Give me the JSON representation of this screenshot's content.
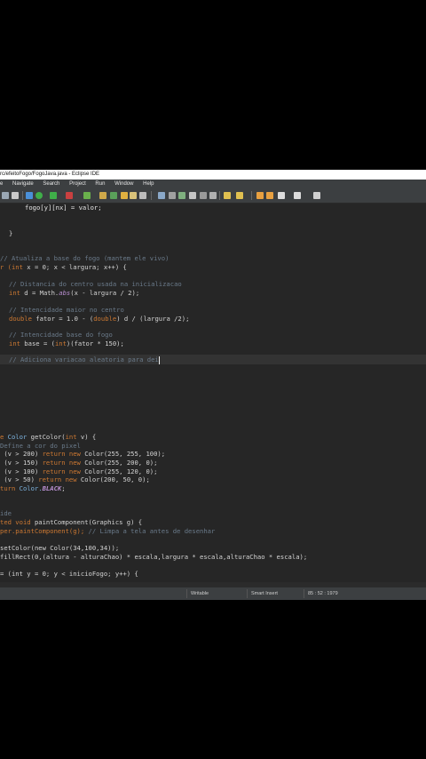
{
  "window": {
    "title": "rc/efeitoFogo/FogoJava.java - Eclipse IDE"
  },
  "menu": [
    "e",
    "Navigate",
    "Search",
    "Project",
    "Run",
    "Window",
    "Help"
  ],
  "editor": {
    "lines": {
      "l1": "fogo[y][nx] = valor;",
      "l2": "}",
      "l3": "// Atualiza a base do fogo (mantem ele vivo)",
      "l4_kw": "r (",
      "l4_int": "int",
      "l4_rest": " x = 0; x < largura; x++) {",
      "l5": "// Distancia do centro usada na inicializacao",
      "l6_int": "int",
      "l6_rest": " d = Math.",
      "l6_abs": "abs",
      "l6_tail": "(x - largura / 2);",
      "l7": "// Intencidade maior no centro",
      "l8_double": "double",
      "l8_rest": " fator = 1.0 - (",
      "l8_double2": "double",
      "l8_tail": ") d / (largura /2);",
      "l9": "// Intencidade base do fogo",
      "l10_int": "int",
      "l10_rest": " base = (",
      "l10_int2": "int",
      "l10_tail": ")(fator * 150);",
      "l11": "// Adiciona variacao aleatoria para dei",
      "l12_a": "e ",
      "l12_color": "Color",
      "l12_b": " getColor(",
      "l12_int": "int",
      "l12_c": " v) {",
      "l13": "Define a cor do pixel",
      "l14_a": " (v > 200) ",
      "l14_ret": "return new ",
      "l14_b": "Color(255, 255, 100);",
      "l15_a": " (v > 150) ",
      "l15_ret": "return new ",
      "l15_b": "Color(255, 200, 0);",
      "l16_a": " (v > 100) ",
      "l16_ret": "return new ",
      "l16_b": "Color(255, 120, 0);",
      "l17_a": " (v > 50) ",
      "l17_ret": "return new ",
      "l17_b": "Color(200, 50, 0);",
      "l18_a": "turn ",
      "l18_b": "Color.",
      "l18_c": "BLACK",
      "l18_d": ";",
      "l19": "ide",
      "l20_a": "ted void ",
      "l20_b": "paintComponent(Graphics g) {",
      "l21_a": "per.paintComponent(g); ",
      "l21_b": "// Limpa a tela antes de desenhar",
      "l22": "setColor(new Color(34,100,34));",
      "l23": "fillRect(0,(altura - alturaChao) * escala,largura * escala,alturaChao * escala);",
      "l24": "= (int y = 0; y < inicioFogo; y++) {"
    }
  },
  "status": {
    "writable": "Writable",
    "insert_mode": "Smart Insert",
    "position": "85 : 52 : 1979"
  },
  "colors": {
    "editor_bg": "#262626",
    "keyword": "#cc7832",
    "comment": "#6a7a8a",
    "type": "#7eb4e0"
  }
}
